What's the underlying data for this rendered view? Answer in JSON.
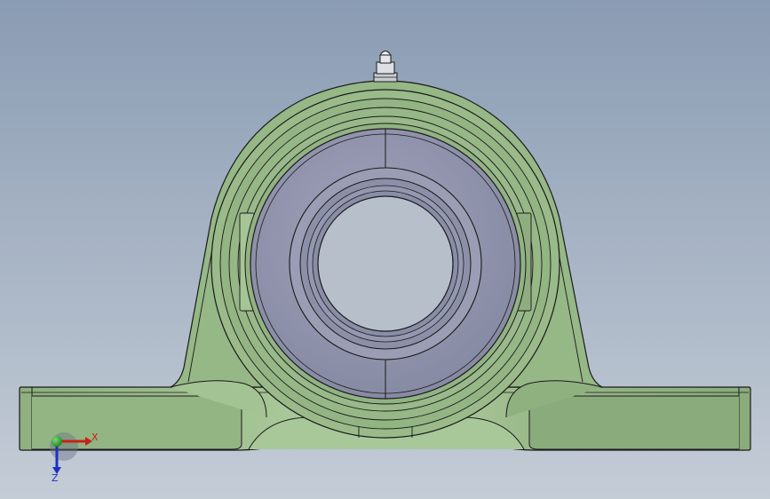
{
  "viewport": {
    "background_top": "#8a9cb3",
    "background_bottom": "#c4ccd6"
  },
  "model": {
    "housing_color": "#96b786",
    "housing_highlight": "#b2cfa2",
    "housing_shadow": "#7e9f70",
    "insert_color": "#8f92ab",
    "insert_light": "#a3a6bd",
    "edge_color": "#1a1a1a"
  },
  "triad": {
    "x_label": "X",
    "z_label": "Z",
    "x_color": "#c8201c",
    "y_color": "#1fa51f",
    "z_color": "#1c2fc4"
  }
}
